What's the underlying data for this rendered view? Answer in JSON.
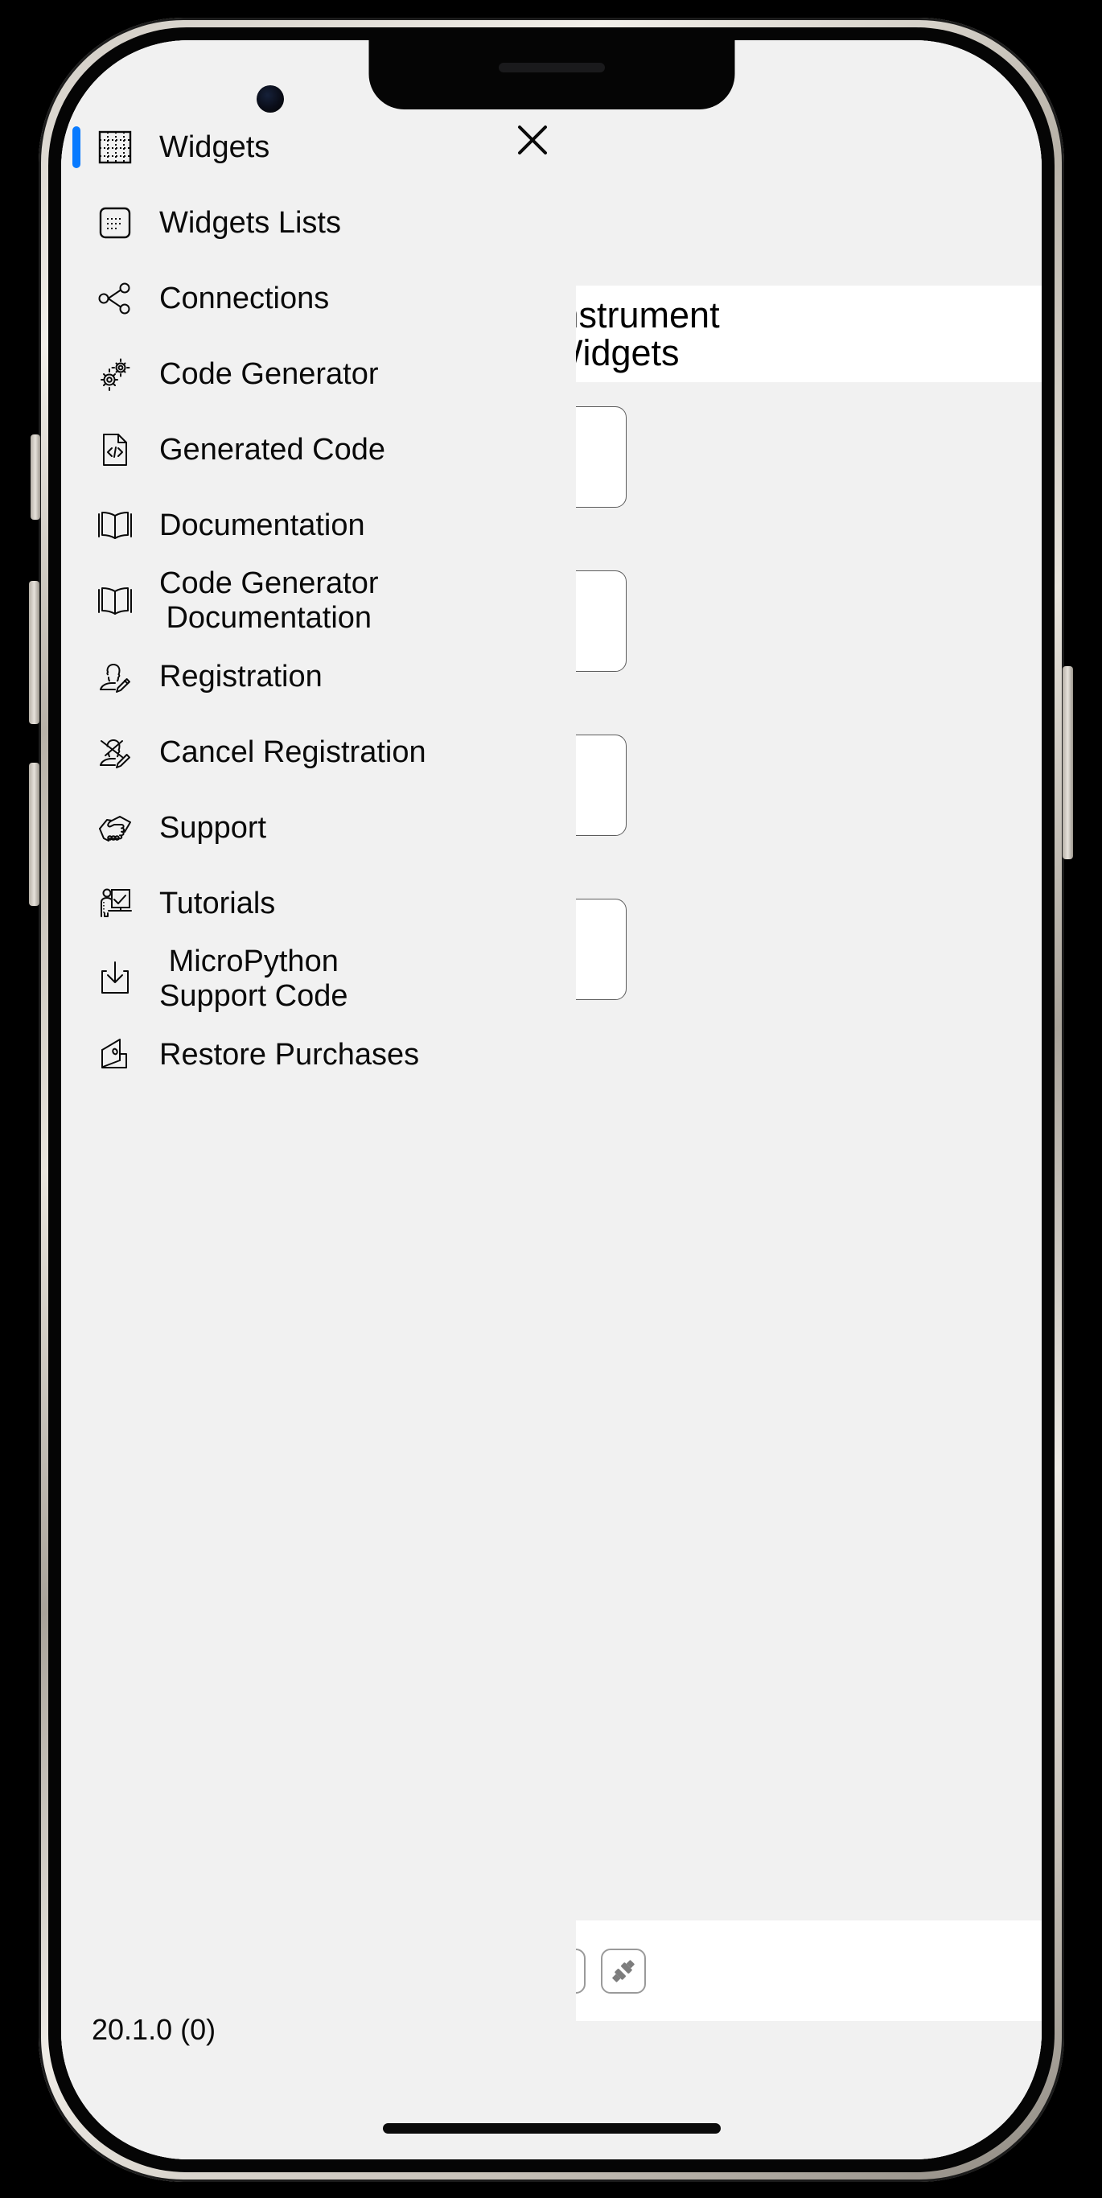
{
  "app": {
    "version_label": "20.1.0 (0)",
    "accent_color": "#087aff",
    "background_color": "#f1f1f1",
    "panel_color": "#ffffff",
    "led_color": "#1d4a6b"
  },
  "drawer": {
    "close_icon": "close-icon",
    "selected_index": 0,
    "items": [
      {
        "label": "Widgets",
        "icon": "grid-icon",
        "selected": true
      },
      {
        "label": "Widgets Lists",
        "icon": "list-icon",
        "selected": false
      },
      {
        "label": "Connections",
        "icon": "network-icon",
        "selected": false
      },
      {
        "label": "Code Generator",
        "icon": "gears-icon",
        "selected": false
      },
      {
        "label": "Generated Code",
        "icon": "code-file-icon",
        "selected": false
      },
      {
        "label": "Documentation",
        "icon": "open-book-icon",
        "selected": false
      },
      {
        "label": "Code Generator\nDocumentation",
        "icon": "open-book-icon",
        "selected": false,
        "centered": true
      },
      {
        "label": "Registration",
        "icon": "user-edit-icon",
        "selected": false
      },
      {
        "label": "Cancel Registration",
        "icon": "user-edit-cancel-icon",
        "selected": false
      },
      {
        "label": "Support",
        "icon": "handshake-icon",
        "selected": false
      },
      {
        "label": "Tutorials",
        "icon": "presenter-icon",
        "selected": false
      },
      {
        "label": "MicroPython\nSupport Code",
        "icon": "download-icon",
        "selected": false,
        "centered": true
      },
      {
        "label": "Restore Purchases",
        "icon": "wallet-icon",
        "selected": false
      }
    ]
  },
  "content": {
    "back_icon": "back-circle-icon",
    "title_line1": "Instrument",
    "title_line2": "Widgets",
    "widgets": [
      {
        "name": "widget-card-1"
      },
      {
        "name": "widget-card-2"
      },
      {
        "name": "widget-card-3"
      },
      {
        "name": "widget-card-4"
      },
      {
        "name": "widget-card-5"
      },
      {
        "name": "widget-card-6"
      },
      {
        "name": "widget-card-7"
      },
      {
        "name": "widget-card-8"
      }
    ],
    "toolbar": [
      {
        "name": "menu-button",
        "icon": "hamburger-icon"
      },
      {
        "name": "status-led",
        "icon": "led-indicator-icon"
      },
      {
        "name": "connect-button",
        "icon": "plug-connected-icon"
      },
      {
        "name": "disconnect-button",
        "icon": "plug-disconnected-icon"
      }
    ]
  }
}
